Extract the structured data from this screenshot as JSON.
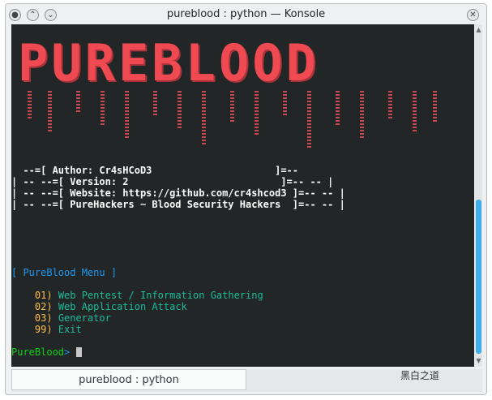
{
  "window": {
    "title": "pureblood : python — Konsole"
  },
  "logo": {
    "text": "PUREBLOOD"
  },
  "banner": {
    "author": "  --=[ Author: Cr4sHCoD3                     ]=--",
    "version": "| -- --=[ Version: 2                          ]=-- -- |",
    "website": "| -- --=[ Website: https://github.com/cr4shcod3 ]=-- -- |",
    "tagline": "| -- --=[ PureHackers ~ Blood Security Hackers  ]=-- -- |"
  },
  "menu": {
    "header": "[ PureBlood Menu ]",
    "items": [
      {
        "num": "01)",
        "label": "Web Pentest / Information Gathering"
      },
      {
        "num": "02)",
        "label": "Web Application Attack"
      },
      {
        "num": "03)",
        "label": "Generator"
      },
      {
        "num": "99)",
        "label": "Exit"
      }
    ]
  },
  "prompt": {
    "name": "PureBlood",
    "symbol": ">"
  },
  "tab": {
    "label": "pureblood : python"
  },
  "watermark": {
    "text": "黑白之道"
  },
  "colors": {
    "accent": "#3daee9",
    "terminal_bg": "#232627",
    "logo": "#ef4a52"
  }
}
